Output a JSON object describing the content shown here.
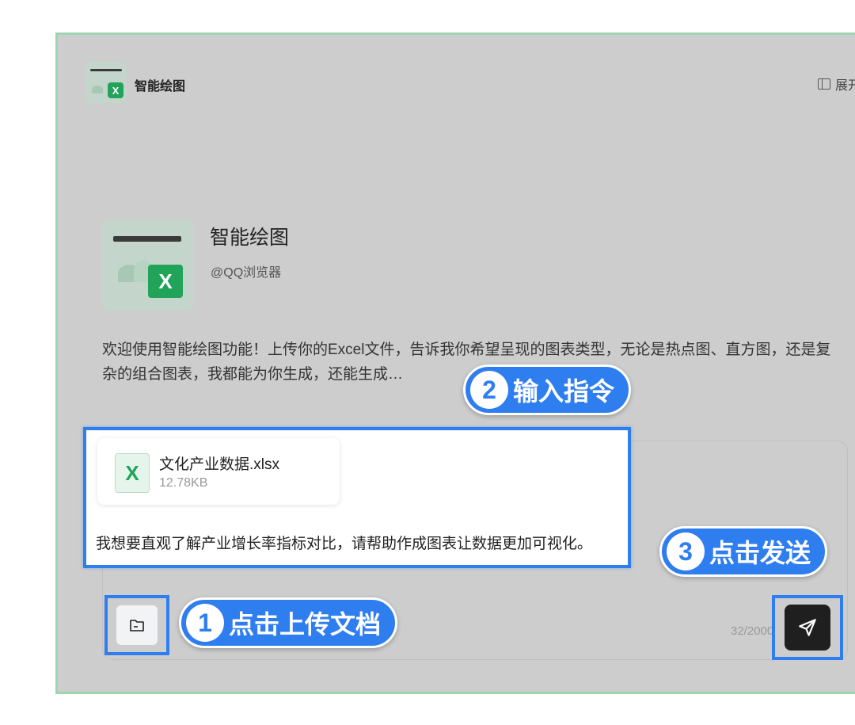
{
  "header": {
    "title": "智能绘图",
    "expand_label": "展开"
  },
  "profile": {
    "name": "智能绘图",
    "author": "@QQ浏览器"
  },
  "intro": "欢迎使用智能绘图功能！上传你的Excel文件，告诉我你希望呈现的图表类型，无论是热点图、直方图，还是复杂的组合图表，我都能为你生成，还能生成…",
  "attachment": {
    "name": "文化产业数据.xlsx",
    "size": "12.78KB",
    "icon_letter": "X"
  },
  "message": "我想要直观了解产业增长率指标对比，请帮助作成图表让数据更加可视化。",
  "counter": "32/2000",
  "callouts": [
    {
      "num": "1",
      "text": "点击上传文档"
    },
    {
      "num": "2",
      "text": "输入指令"
    },
    {
      "num": "3",
      "text": "点击发送"
    }
  ],
  "icons": {
    "logo": "excel-chart-logo-icon",
    "expand": "sidebar-expand-icon",
    "folder": "folder-icon",
    "send": "send-icon"
  },
  "colors": {
    "accent": "#2f7ef0",
    "excel_green": "#21a35a",
    "frame_border": "#9fd4b3"
  }
}
